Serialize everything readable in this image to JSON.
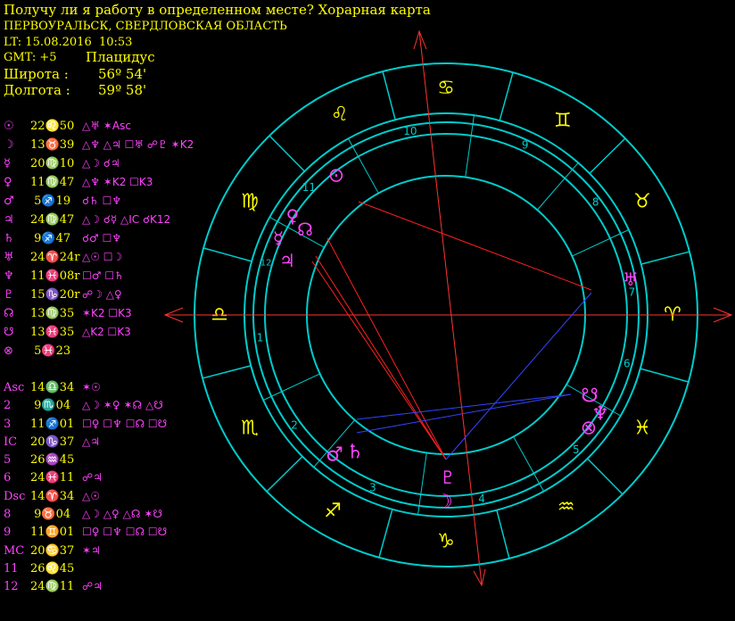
{
  "header": {
    "title": "Получу ли я работу в определенном месте? Хорарная карта",
    "city": "ПЕРВОУРАЛЬСК, СВЕРДЛОВСКАЯ ОБЛАСТЬ",
    "local_time": "LT: 15.08.2016  10:53",
    "gmt": "GMT: +5",
    "house_system": "Плацидус",
    "latitude_label": "Широта :",
    "latitude_value": "56º 54'",
    "longitude_label": "Долгота :",
    "longitude_value": "59º 58'"
  },
  "planets": [
    {
      "sym": "☉",
      "pos": "22♌50",
      "aspects": "△♅ ✶Asc"
    },
    {
      "sym": "☽",
      "pos": "13♉39",
      "aspects": "△♆ △♃ ☐♅ ☍♇ ✶K2"
    },
    {
      "sym": "☿",
      "pos": "20♍10",
      "aspects": "△☽ ☌♃"
    },
    {
      "sym": "♀",
      "pos": "11♍47",
      "aspects": "△♆ ✶K2 ☐K3"
    },
    {
      "sym": "♂",
      "pos": " 5♐19",
      "aspects": "☌♄ ☐♆"
    },
    {
      "sym": "♃",
      "pos": "24♍47",
      "aspects": "△☽ ☌☿ △IC ☌K12"
    },
    {
      "sym": "♄",
      "pos": " 9♐47",
      "aspects": "☌♂ ☐♆"
    },
    {
      "sym": "♅",
      "pos": "24♈24r",
      "aspects": "△☉ ☐☽"
    },
    {
      "sym": "♆",
      "pos": "11♓08r",
      "aspects": "☐♂ ☐♄"
    },
    {
      "sym": "♇",
      "pos": "15♑20r",
      "aspects": "☍☽ △♀"
    },
    {
      "sym": "☊",
      "pos": "13♍35",
      "aspects": "✶K2 ☐K3"
    },
    {
      "sym": "☋",
      "pos": "13♓35",
      "aspects": "△K2 ☐K3"
    },
    {
      "sym": "⊗",
      "pos": " 5♓23",
      "aspects": ""
    }
  ],
  "houses": [
    {
      "sym": "Asc",
      "pos": "14♎34",
      "aspects": "✶☉"
    },
    {
      "sym": "2",
      "pos": " 9♏04",
      "aspects": "△☽ ✶♀ ✶☊ △☋"
    },
    {
      "sym": "3",
      "pos": "11♐01",
      "aspects": "☐♀ ☐♆ ☐☊ ☐☋"
    },
    {
      "sym": "IC",
      "pos": "20♑37",
      "aspects": "△♃"
    },
    {
      "sym": "5",
      "pos": "26♒45",
      "aspects": ""
    },
    {
      "sym": "6",
      "pos": "24♓11",
      "aspects": "☍♃"
    },
    {
      "sym": "Dsc",
      "pos": "14♈34",
      "aspects": "△☉"
    },
    {
      "sym": "8",
      "pos": " 9♉04",
      "aspects": "△☽ △♀ △☊ ✶☋"
    },
    {
      "sym": "9",
      "pos": "11♊01",
      "aspects": "☐♀ ☐♆ ☐☊ ☐☋"
    },
    {
      "sym": "MC",
      "pos": "20♋37",
      "aspects": "✶♃"
    },
    {
      "sym": "11",
      "pos": "26♌45",
      "aspects": ""
    },
    {
      "sym": "12",
      "pos": "24♍11",
      "aspects": "☍♃"
    }
  ],
  "zodiac_glyphs": [
    "♈",
    "♉",
    "♊",
    "♋",
    "♌",
    "♍",
    "♎",
    "♏",
    "♐",
    "♑",
    "♒",
    "♓"
  ],
  "house_numbers": [
    "1",
    "2",
    "3",
    "4",
    "5",
    "6",
    "7",
    "8",
    "9",
    "10",
    "11",
    "12"
  ],
  "wheel_planets": [
    {
      "name": "sun",
      "glyph": "⊙"
    },
    {
      "name": "mercury",
      "glyph": "☿"
    },
    {
      "name": "north-node",
      "glyph": "☊"
    },
    {
      "name": "venus",
      "glyph": "♀"
    },
    {
      "name": "jupiter",
      "glyph": "♃"
    },
    {
      "name": "uranus",
      "glyph": "♅"
    },
    {
      "name": "south-node",
      "glyph": "☋"
    },
    {
      "name": "neptune",
      "glyph": "♆"
    },
    {
      "name": "fortune",
      "glyph": "⊗"
    },
    {
      "name": "pluto",
      "glyph": "♇"
    },
    {
      "name": "moon",
      "glyph": "☽"
    },
    {
      "name": "mars",
      "glyph": "♂"
    },
    {
      "name": "saturn",
      "glyph": "♄"
    }
  ],
  "colors": {
    "background": "#000000",
    "text": "#ffff00",
    "glyph": "#ff44ff",
    "ring": "#00cccc",
    "axis": "#ff3333",
    "aspect_red": "#ff2020",
    "aspect_blue": "#3344ff"
  }
}
